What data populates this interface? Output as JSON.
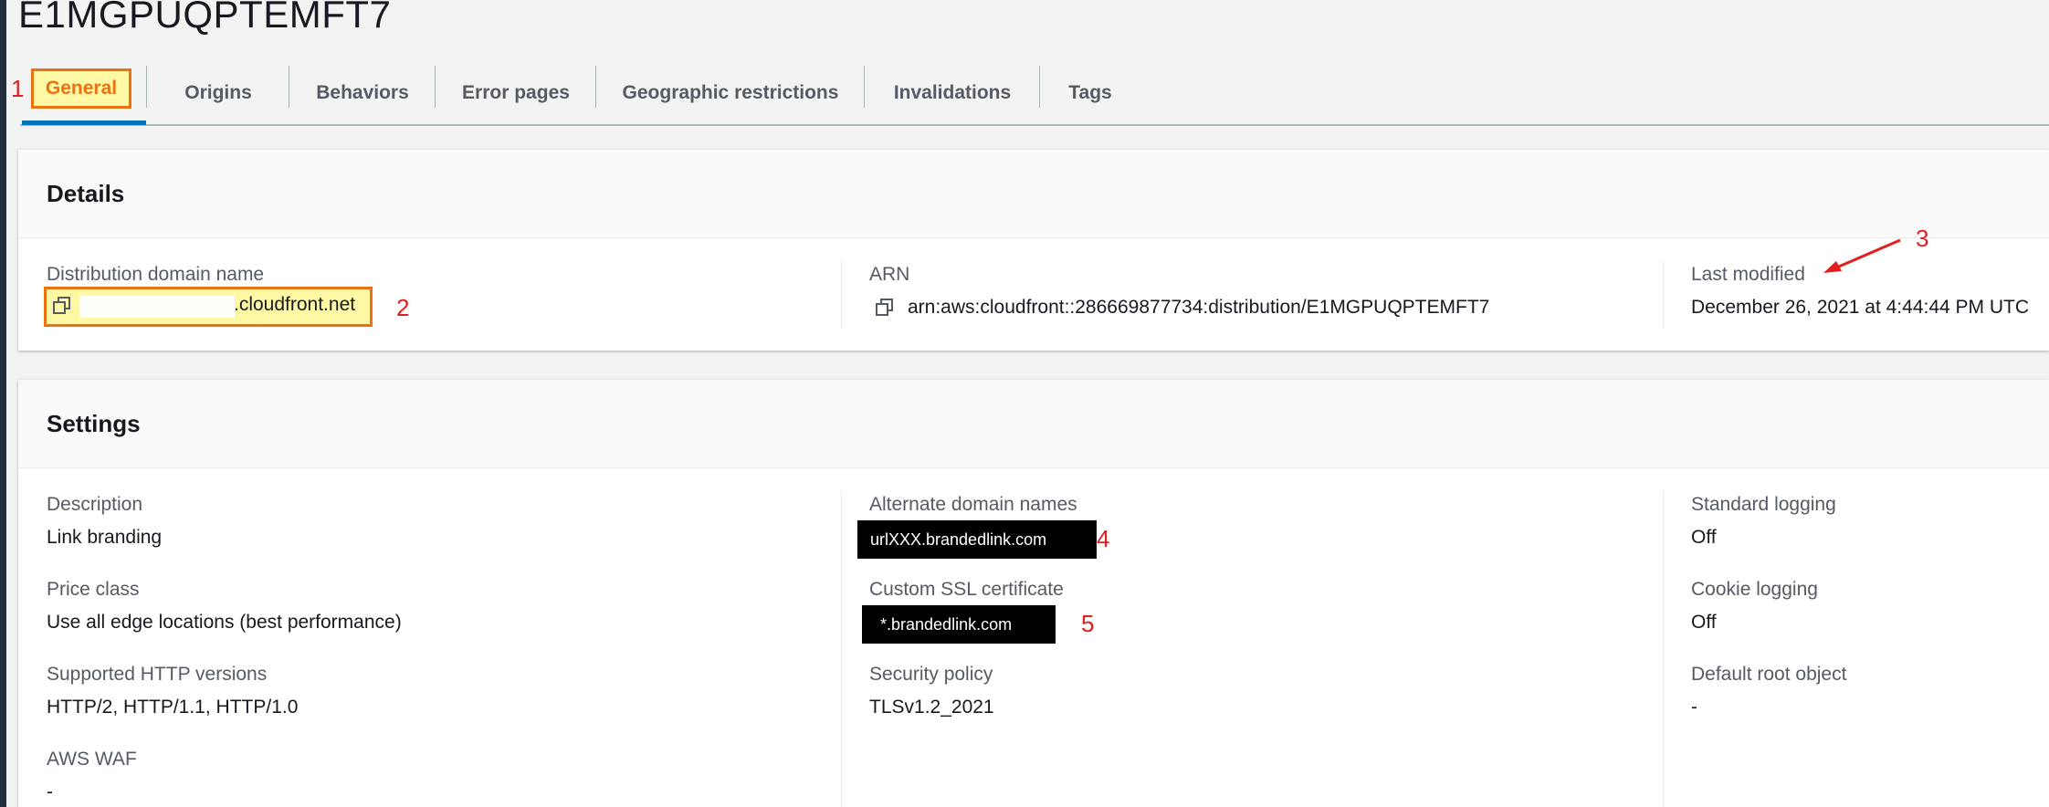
{
  "page_title": "E1MGPUQPTEMFT7",
  "tabs": [
    {
      "label": "General",
      "active": true
    },
    {
      "label": "Origins"
    },
    {
      "label": "Behaviors"
    },
    {
      "label": "Error pages"
    },
    {
      "label": "Geographic restrictions"
    },
    {
      "label": "Invalidations"
    },
    {
      "label": "Tags"
    }
  ],
  "annotations": {
    "m1": "1",
    "m2": "2",
    "m3": "3",
    "m4": "4",
    "m5": "5",
    "color": "#e02020"
  },
  "details": {
    "title": "Details",
    "domain_label": "Distribution domain name",
    "domain_value": ".cloudfront.net",
    "arn_label": "ARN",
    "arn_value": "arn:aws:cloudfront::286669877734:distribution/E1MGPUQPTEMFT7",
    "modified_label": "Last modified",
    "modified_value": "December 26, 2021 at 4:44:44 PM UTC"
  },
  "settings": {
    "title": "Settings",
    "description_label": "Description",
    "description_value": "Link branding",
    "price_label": "Price class",
    "price_value": "Use all edge locations (best performance)",
    "http_label": "Supported HTTP versions",
    "http_value": "HTTP/2, HTTP/1.1, HTTP/1.0",
    "waf_label": "AWS WAF",
    "waf_value": "-",
    "alt_label": "Alternate domain names",
    "alt_value": "urlXXX.brandedlink.com",
    "ssl_label": "Custom SSL certificate",
    "ssl_value": "*.brandedlink.com",
    "security_label": "Security policy",
    "security_value": "TLSv1.2_2021",
    "std_logging_label": "Standard logging",
    "std_logging_value": "Off",
    "cookie_logging_label": "Cookie logging",
    "cookie_logging_value": "Off",
    "root_label": "Default root object",
    "root_value": "-"
  },
  "colors": {
    "accent": "#ec7211",
    "highlight": "#fff9a6",
    "tab_underline": "#0073bb"
  }
}
